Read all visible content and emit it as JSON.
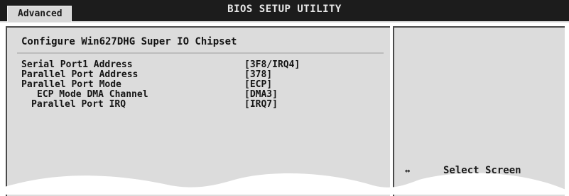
{
  "header": {
    "title": "BIOS SETUP UTILITY",
    "active_tab": "Advanced"
  },
  "section": {
    "title": "Configure Win627DHG Super IO Chipset"
  },
  "settings": [
    {
      "label": "Serial Port1 Address",
      "value": "[3F8/IRQ4]"
    },
    {
      "label": "Parallel Port Address",
      "value": "[378]"
    },
    {
      "label": "Parallel Port Mode",
      "value": "[ECP]"
    },
    {
      "label": "ECP Mode DMA Channel",
      "value": "[DMA3]"
    },
    {
      "label": "Parallel Port IRQ",
      "value": "[IRQ7]"
    }
  ],
  "help": {
    "key_symbol": "↔",
    "key_action": "Select Screen"
  },
  "colors": {
    "topbar": "#1c1c1c",
    "panel": "#dcdcdc",
    "text": "#161616"
  }
}
